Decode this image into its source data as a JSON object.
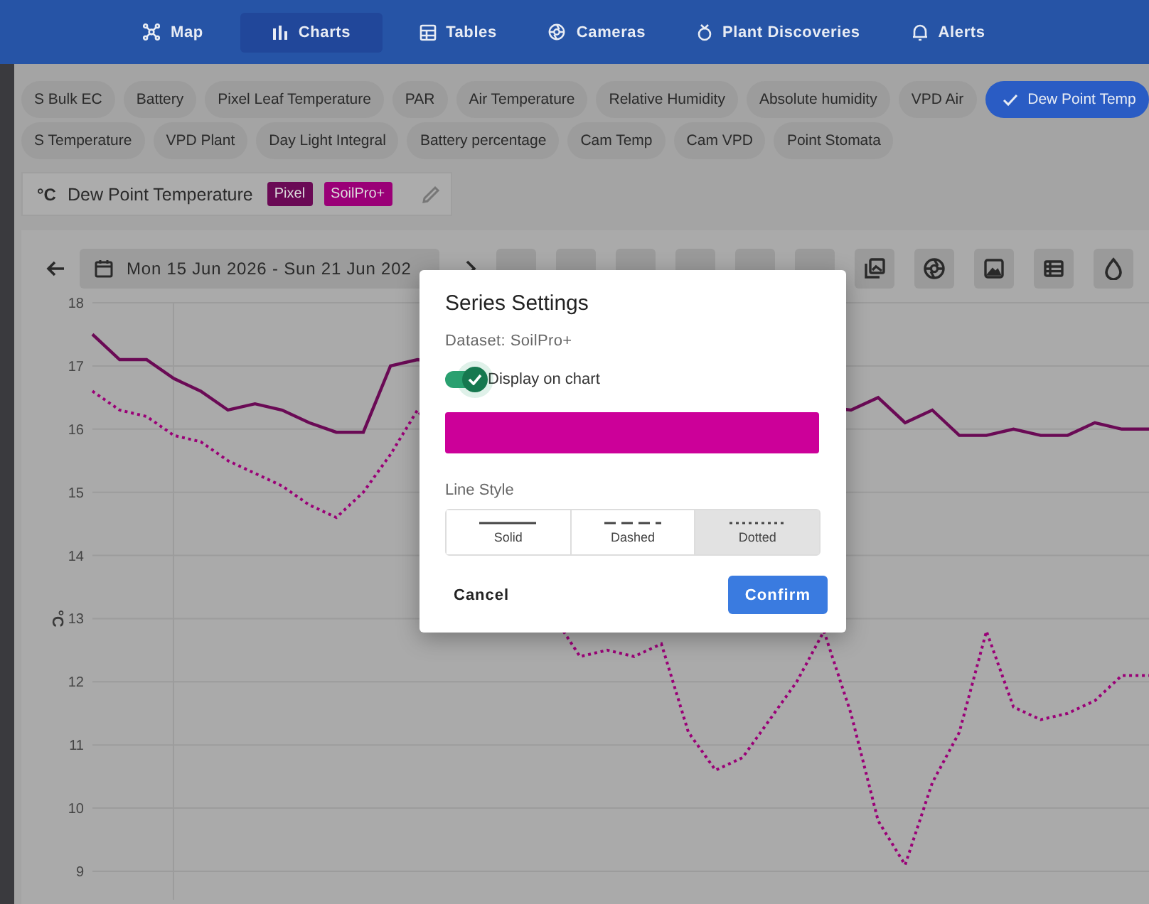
{
  "nav": {
    "items": [
      {
        "label": "Map",
        "selected": false
      },
      {
        "label": "Charts",
        "selected": true
      },
      {
        "label": "Tables",
        "selected": false
      },
      {
        "label": "Cameras",
        "selected": false
      },
      {
        "label": "Plant Discoveries",
        "selected": false
      },
      {
        "label": "Alerts",
        "selected": false
      }
    ]
  },
  "sensor_chips": [
    [
      {
        "label": "S Bulk EC",
        "selected": false
      },
      {
        "label": "Battery",
        "selected": false
      },
      {
        "label": "Pixel Leaf Temperature",
        "selected": false
      },
      {
        "label": "PAR",
        "selected": false
      },
      {
        "label": "Air Temperature",
        "selected": false
      },
      {
        "label": "Relative Humidity",
        "selected": false
      },
      {
        "label": "Absolute humidity",
        "selected": false
      },
      {
        "label": "VPD Air",
        "selected": false
      },
      {
        "label": "Dew Point Temp",
        "selected": true
      }
    ],
    [
      {
        "label": "S Temperature",
        "selected": false
      },
      {
        "label": "VPD Plant",
        "selected": false
      },
      {
        "label": "Day Light Integral",
        "selected": false
      },
      {
        "label": "Battery percentage",
        "selected": false
      },
      {
        "label": "Cam Temp",
        "selected": false
      },
      {
        "label": "Cam VPD",
        "selected": false
      },
      {
        "label": "Point Stomata",
        "selected": false
      }
    ]
  ],
  "series_card": {
    "unit": "°C",
    "title": "Dew Point Temperature"
  },
  "toolbar": {
    "date_range": "Mon 15 Jun 2026 - Sun 21 Jun 202"
  },
  "chart": {
    "chart_data": {
      "type": "line",
      "ylabel": "°C",
      "grid": true,
      "categories": [
        null,
        null,
        null,
        null,
        null,
        null,
        null,
        null,
        null,
        null,
        null,
        null,
        null,
        null,
        null,
        null,
        null,
        null,
        null,
        null,
        null,
        null,
        null,
        null,
        null,
        null,
        null,
        null,
        null,
        null,
        null,
        null,
        null,
        null,
        null,
        null,
        null,
        null,
        null,
        null
      ],
      "ylim": [
        9,
        18
      ],
      "yticks": [
        9,
        10,
        11,
        12,
        13,
        14,
        15,
        16,
        17,
        18
      ],
      "series": [
        {
          "name": "Pixel",
          "color": "#6a0a55",
          "line_style": "solid",
          "values": [
            17.5,
            17.1,
            17.1,
            16.8,
            16.6,
            16.3,
            16.4,
            16.3,
            16.1,
            15.95,
            15.95,
            17.0,
            17.1,
            null,
            null,
            null,
            null,
            null,
            null,
            null,
            null,
            null,
            null,
            null,
            null,
            null,
            null,
            null,
            16.3,
            16.5,
            16.1,
            16.3,
            15.9,
            15.9,
            16.0,
            15.9,
            15.9,
            16.1,
            16.0,
            16.0
          ]
        },
        {
          "name": "SoilPro+",
          "color": "#9a0077",
          "line_style": "dotted",
          "values": [
            16.6,
            16.3,
            16.2,
            15.9,
            15.8,
            15.5,
            15.3,
            15.1,
            14.8,
            14.6,
            15.0,
            15.6,
            16.3,
            null,
            null,
            null,
            null,
            null,
            12.4,
            12.5,
            12.4,
            12.6,
            11.2,
            10.6,
            10.8,
            11.4,
            12.0,
            12.8,
            11.5,
            9.8,
            9.1,
            10.4,
            11.2,
            12.8,
            11.6,
            11.4,
            11.5,
            11.7,
            12.1,
            12.1
          ]
        }
      ]
    }
  },
  "dialog": {
    "title": "Series Settings",
    "dataset": "Dataset: SoilPro+",
    "display_toggle": {
      "label": "Display on chart",
      "on": true
    },
    "color": "#cc0099",
    "line_style_label": "Line Style",
    "line_styles": [
      {
        "label": "Solid",
        "kind": "solid",
        "selected": false
      },
      {
        "label": "Dashed",
        "kind": "dashed",
        "selected": false
      },
      {
        "label": "Dotted",
        "kind": "dotted",
        "selected": true
      }
    ],
    "buttons": {
      "cancel": "Cancel",
      "confirm": "Confirm"
    }
  }
}
